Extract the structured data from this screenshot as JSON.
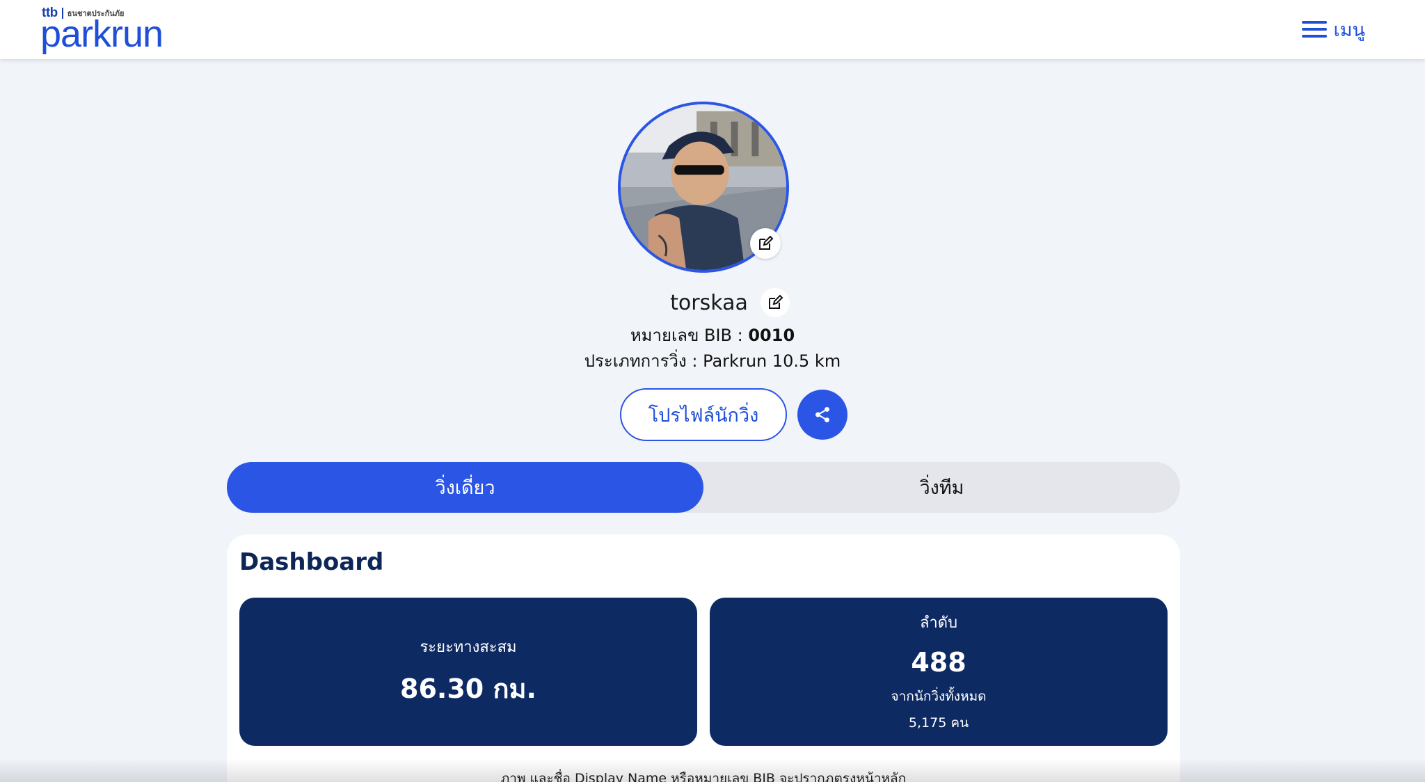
{
  "header": {
    "logo_partner_ttb": "ttb",
    "logo_partner_name": "ธนชาตประกันภัย",
    "logo_text": "parkrun",
    "menu_label": "เมนู"
  },
  "profile": {
    "display_name": "torskaa",
    "bib_label": "หมายเลข BIB : ",
    "bib_value": "0010",
    "run_type_text": "ประเภทการวิ่ง : Parkrun 10.5 km",
    "profile_button_label": "โปรไฟล์นักวิ่ง"
  },
  "tabs": [
    {
      "label": "วิ่งเดี่ยว",
      "active": true
    },
    {
      "label": "วิ่งทีม",
      "active": false
    }
  ],
  "dashboard": {
    "title": "Dashboard",
    "distance_label": "ระยะทางสะสม",
    "distance_value": "86.30 กม.",
    "rank_label": "ลำดับ",
    "rank_value": "488",
    "rank_sub": "จากนักวิ่งทั้งหมด",
    "rank_total": "5,175 คน",
    "footnote": "ภาพ และชื่อ Display Name หรือหมายเลข BIB จะปรากฎตรงหน้าหลัก"
  },
  "colors": {
    "brand_blue": "#2a55e5",
    "navy": "#0e2a63",
    "page_bg": "#f1f4f9"
  }
}
